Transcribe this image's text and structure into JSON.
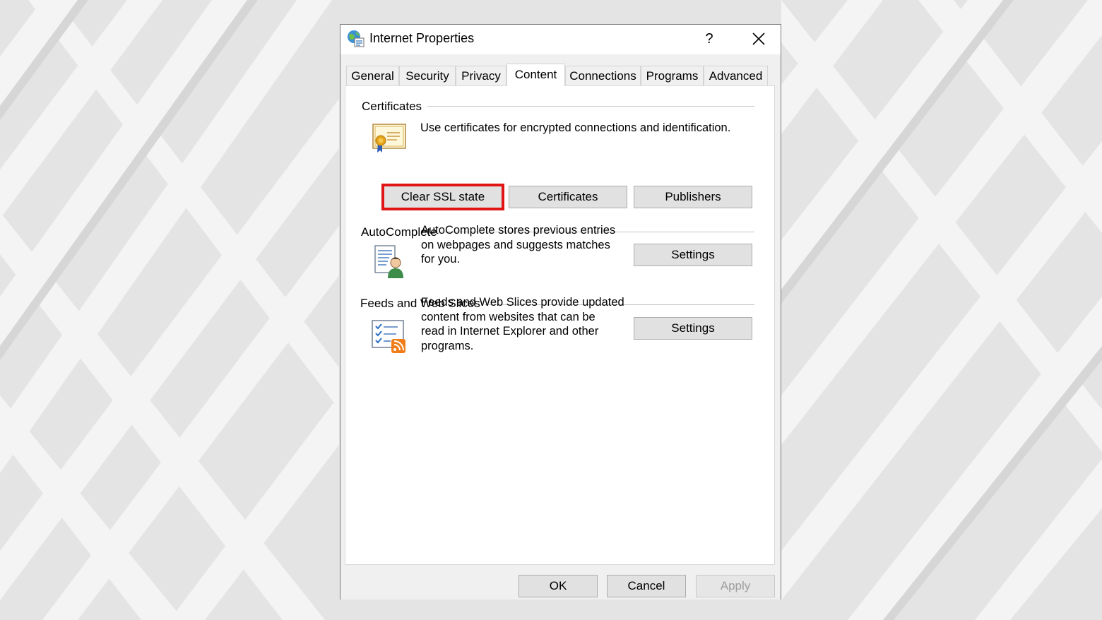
{
  "window": {
    "title": "Internet Properties",
    "help_label": "?"
  },
  "tabs": [
    {
      "label": "General",
      "active": false
    },
    {
      "label": "Security",
      "active": false
    },
    {
      "label": "Privacy",
      "active": false
    },
    {
      "label": "Content",
      "active": true
    },
    {
      "label": "Connections",
      "active": false
    },
    {
      "label": "Programs",
      "active": false
    },
    {
      "label": "Advanced",
      "active": false
    }
  ],
  "certificates": {
    "heading": "Certificates",
    "description": "Use certificates for encrypted connections and identification.",
    "icon": "certificate-icon",
    "clear_ssl_label": "Clear SSL state",
    "certificates_label": "Certificates",
    "publishers_label": "Publishers"
  },
  "autocomplete": {
    "heading": "AutoComplete",
    "description_lines": [
      "AutoComplete stores previous entries",
      "on webpages and suggests matches",
      "for you."
    ],
    "icon": "autocomplete-icon",
    "settings_label": "Settings"
  },
  "feeds": {
    "heading": "Feeds and Web Slices",
    "description_lines": [
      "Feeds and Web Slices provide updated",
      "content from websites that can be",
      "read in Internet Explorer and other",
      "programs."
    ],
    "icon": "feeds-icon",
    "settings_label": "Settings"
  },
  "footer": {
    "ok_label": "OK",
    "cancel_label": "Cancel",
    "apply_label": "Apply"
  },
  "colors": {
    "highlight": "#e01616",
    "dialog_bg": "#f0f0f0",
    "panel_bg": "#ffffff",
    "button_bg": "#e1e1e1"
  }
}
